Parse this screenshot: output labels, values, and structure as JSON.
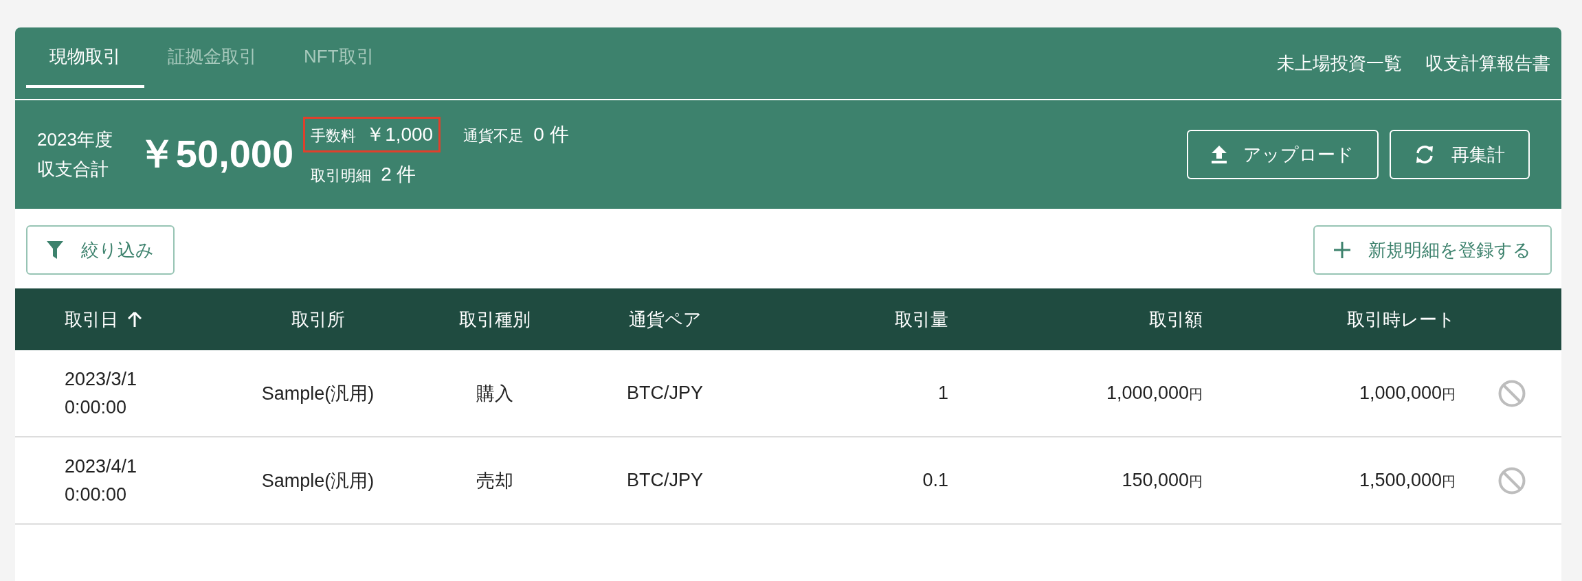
{
  "tabs": [
    {
      "label": "現物取引",
      "selected": true
    },
    {
      "label": "証拠金取引",
      "selected": false
    },
    {
      "label": "NFT取引",
      "selected": false
    }
  ],
  "header_links": [
    "未上場投資一覧",
    "収支計算報告書"
  ],
  "summary": {
    "label_lines": [
      "2023年度",
      "収支合計"
    ],
    "total": "￥50,000",
    "stats": [
      {
        "label": "手数料",
        "value": "￥1,000",
        "highlighted": true
      },
      {
        "label": "通貨不足",
        "value": "0 件",
        "highlighted": false
      },
      {
        "label": "取引明細",
        "value": "2 件",
        "highlighted": false
      }
    ],
    "buttons": [
      {
        "kind": "upload",
        "label": "アップロード"
      },
      {
        "kind": "refresh",
        "label": "再集計"
      }
    ]
  },
  "toolbar": {
    "filter_button": "絞り込み",
    "add_button": "新規明細を登録する"
  },
  "table": {
    "columns": [
      {
        "label": "取引日",
        "sorted": true
      },
      {
        "label": "取引所",
        "sorted": false
      },
      {
        "label": "取引種別",
        "sorted": false
      },
      {
        "label": "通貨ペア",
        "sorted": false
      },
      {
        "label": "取引量",
        "sorted": false
      },
      {
        "label": "取引額",
        "sorted": false
      },
      {
        "label": "取引時レート",
        "sorted": false
      }
    ],
    "rows": [
      {
        "date": "2023/3/1",
        "time": "0:00:00",
        "exchange": "Sample(汎用)",
        "type": "購入",
        "pair": "BTC/JPY",
        "quantity": "1",
        "amount": "1,000,000",
        "amount_unit": "円",
        "rate": "1,000,000",
        "rate_unit": "円"
      },
      {
        "date": "2023/4/1",
        "time": "0:00:00",
        "exchange": "Sample(汎用)",
        "type": "売却",
        "pair": "BTC/JPY",
        "quantity": "0.1",
        "amount": "150,000",
        "amount_unit": "円",
        "rate": "1,500,000",
        "rate_unit": "円"
      }
    ]
  }
}
